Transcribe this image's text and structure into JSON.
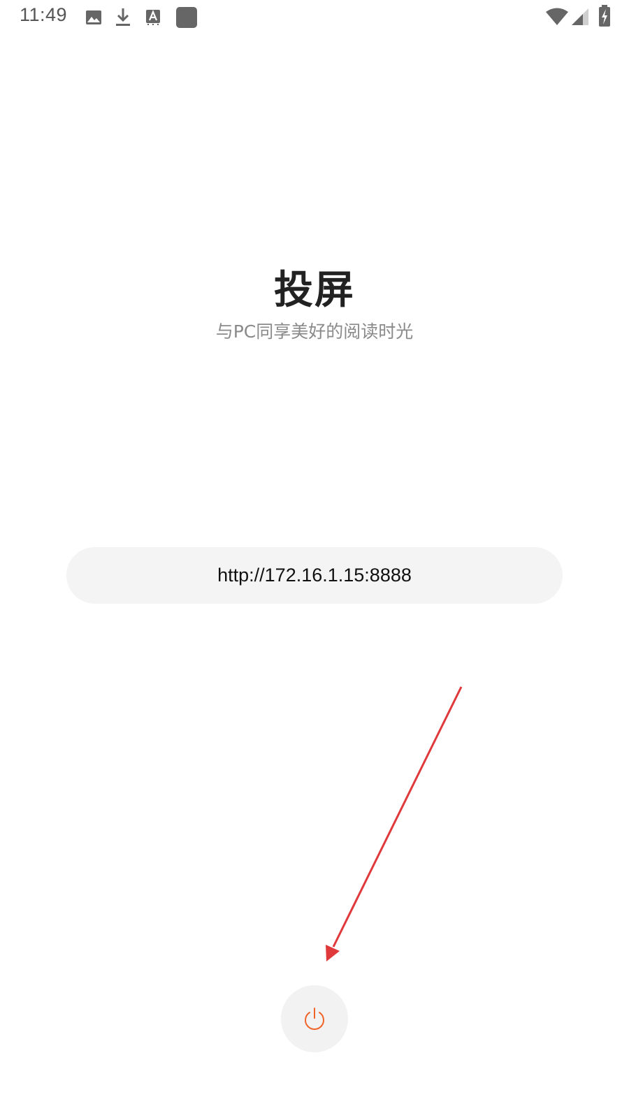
{
  "status_bar": {
    "time": "11:49",
    "icons": [
      "image-icon",
      "download-icon",
      "keyboard-a-icon",
      "app-square-icon",
      "wifi-icon",
      "signal-icon",
      "battery-charging-icon"
    ]
  },
  "main": {
    "title": "投屏",
    "subtitle": "与PC同享美好的阅读时光",
    "url": "http://172.16.1.15:8888"
  },
  "power_button": {
    "icon": "power-icon",
    "accent_color": "#f0642a"
  },
  "annotation": {
    "arrow_color": "#e0393b"
  },
  "colors": {
    "background": "#ffffff",
    "pill_background": "#f4f4f4",
    "title_color": "#222222",
    "subtitle_color": "#8a8a8a"
  }
}
